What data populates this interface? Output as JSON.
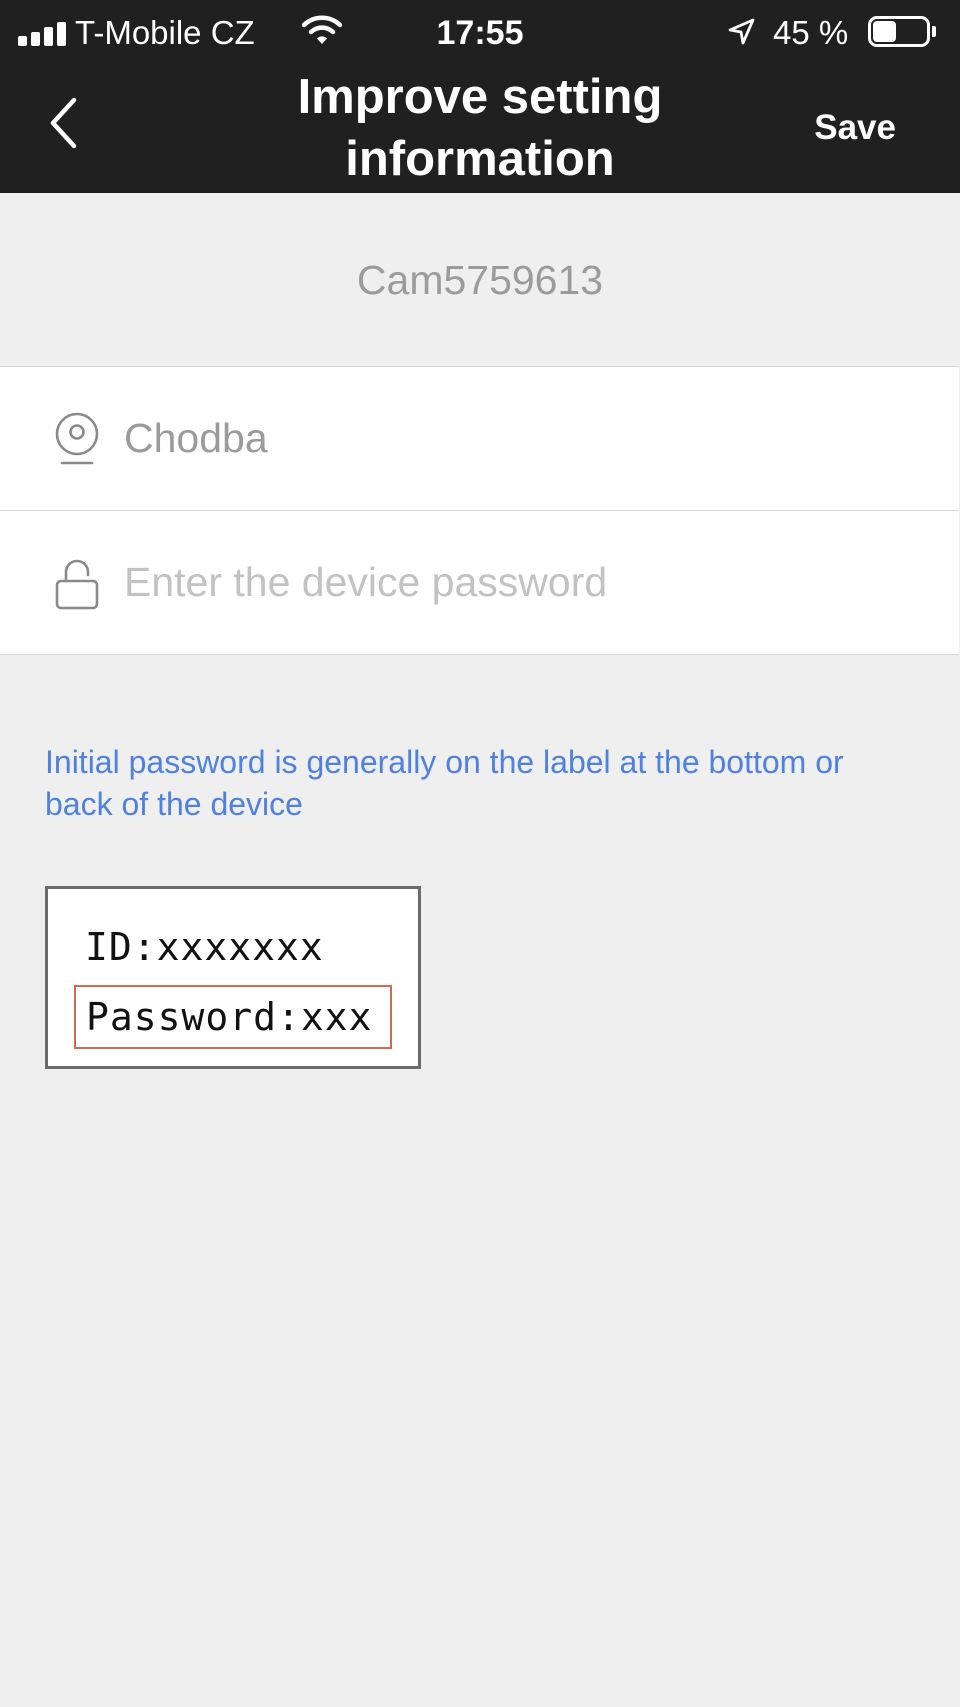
{
  "status_bar": {
    "carrier": "T-Mobile CZ",
    "time": "17:55",
    "battery_percent": "45 %",
    "battery_level": 0.45,
    "signal_bars": 4
  },
  "nav": {
    "title": "Improve setting information",
    "save_label": "Save",
    "back_icon": "chevron-left-icon"
  },
  "device": {
    "id": "Cam5759613"
  },
  "form": {
    "name_value": "Chodba",
    "name_icon": "camera-icon",
    "password_value": "",
    "password_placeholder": "Enter the device password",
    "password_icon": "lock-icon"
  },
  "hint": "Initial password is generally on the label at the bottom or back of the device",
  "label_example": {
    "id_line": "ID:xxxxxxx",
    "password_line": "Password:xxx",
    "highlight_color": "#cf6a55"
  },
  "colors": {
    "header_bg": "#202020",
    "page_bg": "#efeff0",
    "hint_text": "#4f81e0"
  }
}
